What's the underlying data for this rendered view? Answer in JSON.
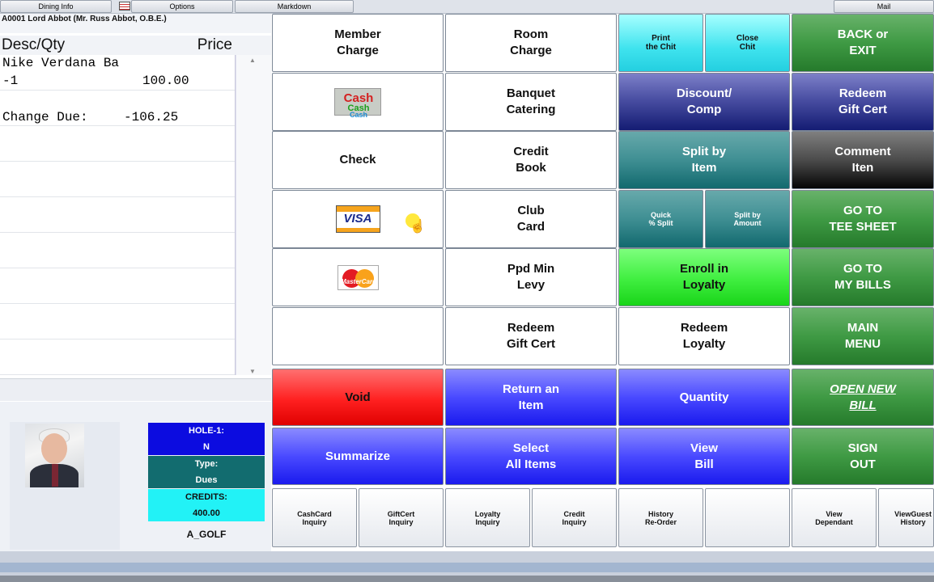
{
  "menu": {
    "dining_info": "Dining Info",
    "options": "Options",
    "markdown": "Markdown",
    "mail": "Mail"
  },
  "customer": "A0001 Lord Abbot (Mr. Russ Abbot, O.B.E.)",
  "header": {
    "desc_qty": "Desc/Qty",
    "price": "Price"
  },
  "item": {
    "description": "Nike Verdana Ba",
    "qty": "-1",
    "price": "100.00"
  },
  "change_due": {
    "label": "Change Due:",
    "value": "-106.25"
  },
  "member_info": {
    "hole_label": "HOLE-1:",
    "hole_value": "N",
    "type_label": "Type:",
    "type_value": "Dues",
    "credits_label": "CREDITS:",
    "credits_value": "400.00",
    "group": "A_GOLF"
  },
  "payment": {
    "member_charge": "Member\nCharge",
    "cash_icon": "cash-icon",
    "cash_text": "Cash",
    "check": "Check",
    "visa_icon": "visa-icon",
    "visa_text": "VISA",
    "mastercard_icon": "mastercard-icon",
    "mastercard_text": "MasterCard"
  },
  "col2": {
    "room_charge": "Room\nCharge",
    "banquet": "Banquet\nCatering",
    "credit_book": "Credit\nBook",
    "club_card": "Club\nCard",
    "ppd_min": "Ppd Min\nLevy",
    "redeem_gift": "Redeem\nGift Cert"
  },
  "col3": {
    "print_chit": "Print\nthe Chit",
    "close_chit": "Close\nChit",
    "discount": "Discount/\nComp",
    "split_item": "Split by\nItem",
    "quick_split": "Quick\n% Split",
    "split_amount": "Split by\nAmount",
    "enroll_loyalty": "Enroll in\nLoyalty",
    "redeem_loyalty": "Redeem\nLoyalty"
  },
  "col4": {
    "back_exit": "BACK or\nEXIT",
    "redeem_gift": "Redeem\nGift Cert",
    "comment_item": "Comment\nIten",
    "tee_sheet": "GO TO\nTEE SHEET",
    "my_bills": "GO TO\nMY BILLS",
    "main_menu": "MAIN\nMENU"
  },
  "actions": {
    "void": "Void",
    "return_item": "Return an\nItem",
    "quantity": "Quantity",
    "open_new_bill": "OPEN NEW\nBILL",
    "summarize": "Summarize",
    "select_all": "Select\nAll Items",
    "view_bill": "View\nBill",
    "sign_out": "SIGN\nOUT"
  },
  "inquiries": {
    "cashcard": "CashCard\nInquiry",
    "giftcert": "GiftCert\nInquiry",
    "loyalty": "Loyalty\nInquiry",
    "credit": "Credit\nInquiry",
    "history": "History\nRe-Order",
    "blank": "",
    "view_dependant": "View\nDependant",
    "view_guest_history": "ViewGuest\nHistory"
  },
  "colors": {
    "cyan": "#3fe3ee",
    "green": "#3f9a44",
    "navy": "#141c73",
    "teal": "#12696e",
    "lime": "#3fee3f",
    "red": "#ff2020",
    "blue": "#1a1aee"
  }
}
